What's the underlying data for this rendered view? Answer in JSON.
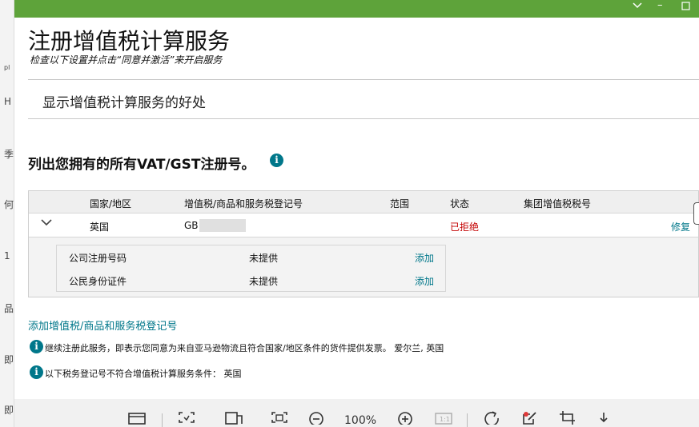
{
  "window": {
    "accent_color": "#5ea33a",
    "controls": [
      "chevron-down-icon",
      "minimize-icon",
      "maximize-icon"
    ]
  },
  "left_strip": {
    "fragments": [
      "pl",
      "H",
      "季",
      "何",
      "1",
      "品",
      "即",
      "即"
    ]
  },
  "header": {
    "title": "注册增值税计算服务",
    "subtitle": "检查以下设置并点击“同意并激活”来开启服务"
  },
  "benefits": {
    "label": "显示增值税计算服务的好处"
  },
  "registrations": {
    "heading": "列出您拥有的所有VAT/GST注册号。",
    "info_icon": "info-icon",
    "columns": [
      "国家/地区",
      "增值税/商品和服务税登记号",
      "范围",
      "状态",
      "集团增值税税号"
    ],
    "rows": [
      {
        "country": "英国",
        "vat_number": "GB",
        "scope": "",
        "status": "已拒绝",
        "status_color": "#c40000",
        "group_vat": "",
        "action": "修复",
        "details": [
          {
            "label": "公司注册号码",
            "value": "未提供",
            "action": "添加"
          },
          {
            "label": "公民身份证件",
            "value": "未提供",
            "action": "添加"
          }
        ]
      }
    ]
  },
  "add_link": "添加增值税/商品和服务税登记号",
  "notices": [
    "继续注册此服务，即表示您同意为来自亚马逊物流且符合国家/地区条件的货件提供发票。 爱尔兰, 英国",
    "以下税务登记号不符合增值税计算服务条件： 英国"
  ],
  "toolbar": {
    "zoom": "100%",
    "icons": [
      "sidebar-icon",
      "ocr-icon",
      "translate-icon",
      "fit-page-icon",
      "zoom-out-icon",
      "zoom-in-icon",
      "actual-size-icon",
      "rotate-icon",
      "annotate-icon",
      "crop-icon",
      "download-icon"
    ]
  }
}
